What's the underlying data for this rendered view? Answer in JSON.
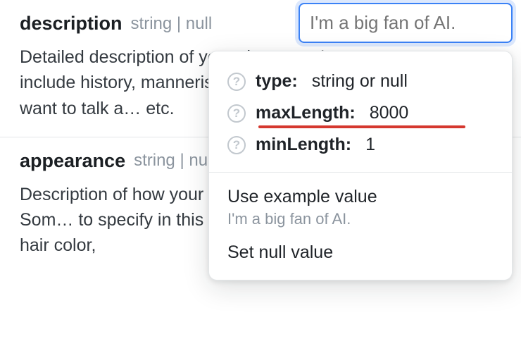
{
  "fields": [
    {
      "name": "description",
      "type_label": "string | null",
      "desc": "Detailed description of your character. It can include history, mannerisms, bac… things they want to talk a… etc."
    },
    {
      "name": "appearance",
      "type_label": "string | null",
      "desc": "Description of how your character looks like. Som… to specify in this field: gender,ethnicity, hair color,"
    }
  ],
  "input": {
    "value": "",
    "placeholder": "I'm a big fan of AI."
  },
  "popover": {
    "meta": [
      {
        "key": "type",
        "value": "string or null",
        "emphasis": false
      },
      {
        "key": "maxLength",
        "value": "8000",
        "emphasis": true
      },
      {
        "key": "minLength",
        "value": "1",
        "emphasis": false
      }
    ],
    "use_example_label": "Use example value",
    "use_example_preview": "I'm a big fan of AI.",
    "set_null_label": "Set null value"
  }
}
